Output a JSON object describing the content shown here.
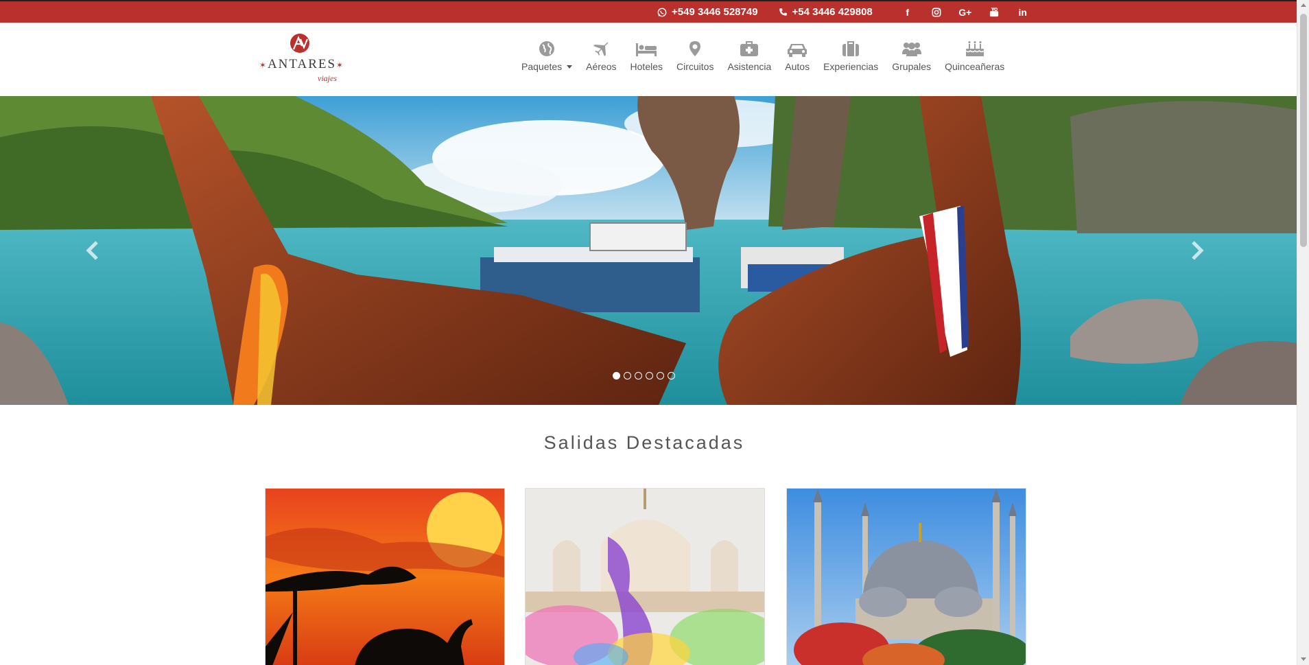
{
  "colors": {
    "brand": "#b9302c",
    "nav_icon": "#9a9a9a",
    "text": "#555555"
  },
  "topbar": {
    "whatsapp": {
      "icon": "whatsapp-icon",
      "number": "+549 3446 528749"
    },
    "phone": {
      "icon": "phone-icon",
      "number": "+54 3446 429808"
    },
    "social": [
      {
        "icon": "facebook-icon",
        "glyph": "f"
      },
      {
        "icon": "instagram-icon",
        "glyph": ""
      },
      {
        "icon": "google-plus-icon",
        "glyph": "G+"
      },
      {
        "icon": "youtube-icon",
        "glyph": ""
      },
      {
        "icon": "linkedin-icon",
        "glyph": "in"
      }
    ]
  },
  "logo": {
    "name": "ANTARES",
    "sub": "viajes",
    "mark": "AV"
  },
  "nav": {
    "items": [
      {
        "label": "Paquetes",
        "icon": "globe-icon",
        "dropdown": true
      },
      {
        "label": "Aéreos",
        "icon": "plane-icon"
      },
      {
        "label": "Hoteles",
        "icon": "bed-icon"
      },
      {
        "label": "Circuitos",
        "icon": "map-marker-icon"
      },
      {
        "label": "Asistencia",
        "icon": "medkit-icon"
      },
      {
        "label": "Autos",
        "icon": "car-icon"
      },
      {
        "label": "Experiencias",
        "icon": "suitcase-icon"
      },
      {
        "label": "Grupales",
        "icon": "users-icon"
      },
      {
        "label": "Quinceañeras",
        "icon": "birthday-cake-icon"
      }
    ]
  },
  "carousel": {
    "slides": 6,
    "active_index": 0
  },
  "section": {
    "title": "Salidas Destacadas"
  },
  "cards": [
    {
      "image": "africa-sunset-elephant"
    },
    {
      "image": "india-holi-temple"
    },
    {
      "image": "istanbul-blue-mosque"
    }
  ]
}
